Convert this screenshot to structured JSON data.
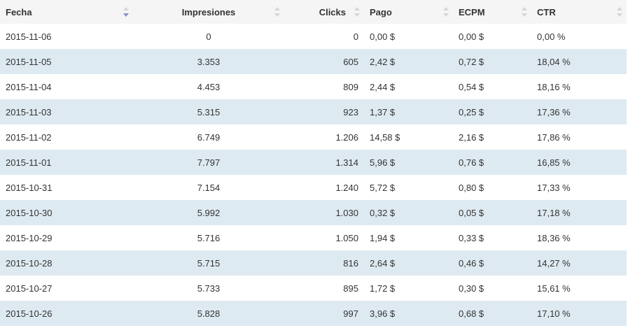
{
  "table": {
    "columns": [
      {
        "key": "fecha",
        "label": "Fecha",
        "sort": "desc"
      },
      {
        "key": "impresiones",
        "label": "Impresiones",
        "sort": "none"
      },
      {
        "key": "clicks",
        "label": "Clicks",
        "sort": "none"
      },
      {
        "key": "pago",
        "label": "Pago",
        "sort": "none"
      },
      {
        "key": "ecpm",
        "label": "ECPM",
        "sort": "none"
      },
      {
        "key": "ctr",
        "label": "CTR",
        "sort": "none"
      }
    ],
    "rows": [
      {
        "fecha": "2015-11-06",
        "impresiones": "0",
        "clicks": "0",
        "pago": "0,00 $",
        "ecpm": "0,00 $",
        "ctr": "0,00 %"
      },
      {
        "fecha": "2015-11-05",
        "impresiones": "3.353",
        "clicks": "605",
        "pago": "2,42 $",
        "ecpm": "0,72 $",
        "ctr": "18,04 %"
      },
      {
        "fecha": "2015-11-04",
        "impresiones": "4.453",
        "clicks": "809",
        "pago": "2,44 $",
        "ecpm": "0,54 $",
        "ctr": "18,16 %"
      },
      {
        "fecha": "2015-11-03",
        "impresiones": "5.315",
        "clicks": "923",
        "pago": "1,37 $",
        "ecpm": "0,25 $",
        "ctr": "17,36 %"
      },
      {
        "fecha": "2015-11-02",
        "impresiones": "6.749",
        "clicks": "1.206",
        "pago": "14,58 $",
        "ecpm": "2,16 $",
        "ctr": "17,86 %"
      },
      {
        "fecha": "2015-11-01",
        "impresiones": "7.797",
        "clicks": "1.314",
        "pago": "5,96 $",
        "ecpm": "0,76 $",
        "ctr": "16,85 %"
      },
      {
        "fecha": "2015-10-31",
        "impresiones": "7.154",
        "clicks": "1.240",
        "pago": "5,72 $",
        "ecpm": "0,80 $",
        "ctr": "17,33 %"
      },
      {
        "fecha": "2015-10-30",
        "impresiones": "5.992",
        "clicks": "1.030",
        "pago": "0,32 $",
        "ecpm": "0,05 $",
        "ctr": "17,18 %"
      },
      {
        "fecha": "2015-10-29",
        "impresiones": "5.716",
        "clicks": "1.050",
        "pago": "1,94 $",
        "ecpm": "0,33 $",
        "ctr": "18,36 %"
      },
      {
        "fecha": "2015-10-28",
        "impresiones": "5.715",
        "clicks": "816",
        "pago": "2,64 $",
        "ecpm": "0,46 $",
        "ctr": "14,27 %"
      },
      {
        "fecha": "2015-10-27",
        "impresiones": "5.733",
        "clicks": "895",
        "pago": "1,72 $",
        "ecpm": "0,30 $",
        "ctr": "15,61 %"
      },
      {
        "fecha": "2015-10-26",
        "impresiones": "5.828",
        "clicks": "997",
        "pago": "3,96 $",
        "ecpm": "0,68 $",
        "ctr": "17,10 %"
      }
    ]
  },
  "icons": {
    "sort": "sort-arrows-icon",
    "sort_active": "sort-desc-icon"
  },
  "colors": {
    "header_bg": "#f5f5f5",
    "row_alt_bg": "#deeaf1",
    "row_bg": "#ffffff",
    "sort_active": "#8a8fd1",
    "sort_inactive": "#d7d7d7",
    "text": "#333333"
  }
}
